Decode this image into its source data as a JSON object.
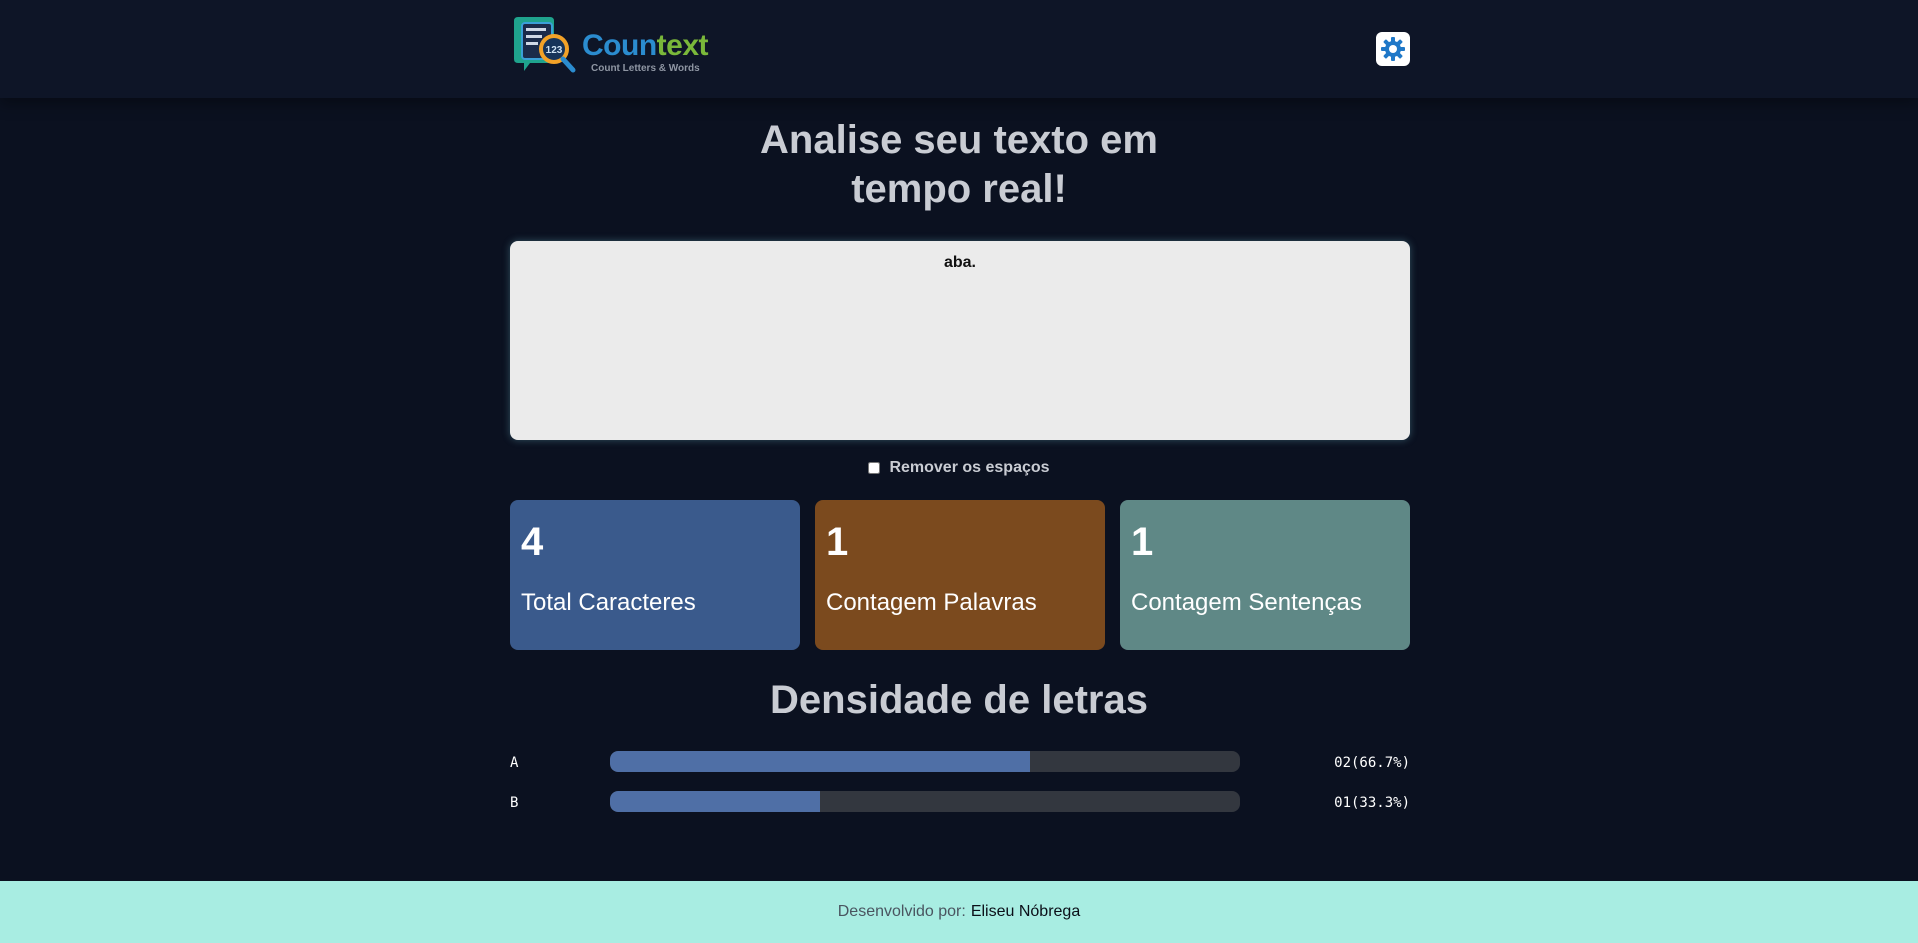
{
  "header": {
    "logo_title_part1": "Coun",
    "logo_title_part2": "text",
    "logo_subtitle": "Count Letters & Words",
    "logo_badge": "123",
    "settings_icon": "gear-icon"
  },
  "main": {
    "title_line1": "Analise seu texto em",
    "title_line2": "tempo real!",
    "textarea_value": "aba.",
    "remove_spaces_label": "Remover os espaços",
    "remove_spaces_checked": false
  },
  "stats": [
    {
      "value": "4",
      "label": "Total Caracteres",
      "color": "#3a5a8c"
    },
    {
      "value": "1",
      "label": "Contagem Palavras",
      "color": "#7b4a1e"
    },
    {
      "value": "1",
      "label": "Contagem Sentenças",
      "color": "#5f8886"
    }
  ],
  "density": {
    "title": "Densidade de letras",
    "rows": [
      {
        "letter": "A",
        "count_label": "02(66.7%)",
        "percent": 66.7
      },
      {
        "letter": "B",
        "count_label": "01(33.3%)",
        "percent": 33.3
      }
    ]
  },
  "footer": {
    "prefix": "Desenvolvido por:",
    "author": "Eliseu Nóbrega"
  },
  "colors": {
    "background": "#0b1120",
    "footer_bg": "#a8ede2",
    "bar_fill": "#4f6fa6",
    "bar_track": "#33373f"
  }
}
